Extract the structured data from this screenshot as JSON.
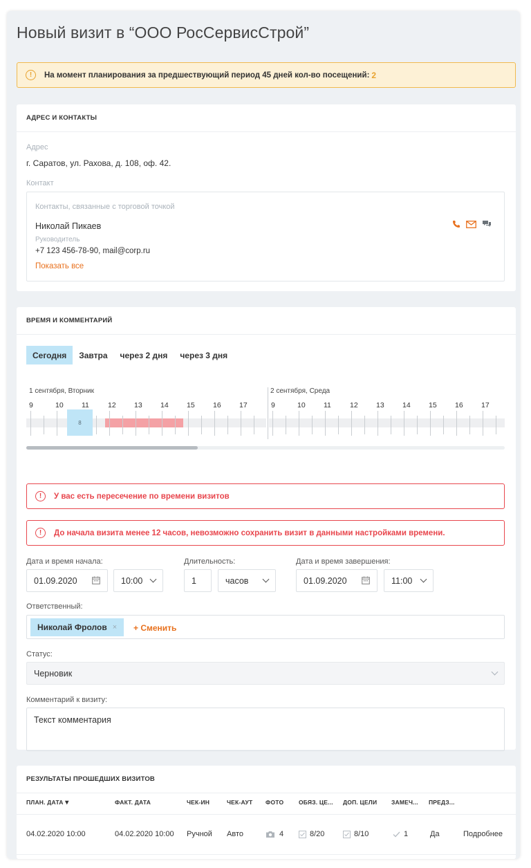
{
  "page": {
    "title": "Новый визит в “ООО РосСервисСтрой”",
    "warning_text": "На момент планирования за предшествующий период 45 дней кол-во посещений:",
    "warning_count": "2",
    "warning_icon": "!"
  },
  "address_section": {
    "heading": "АДРЕС И КОНТАКТЫ",
    "address_label": "Адрес",
    "address_value": "г. Саратов, ул. Рахова, д. 108, оф. 42.",
    "contact_label": "Контакт",
    "contacts_caption": "Контакты, связанные с торговой точкой",
    "contact_name": "Николай Пикаев",
    "contact_role": "Руководитель",
    "contact_details": "+7 123 456-78-90, mail@corp.ru",
    "show_all": "Показать все"
  },
  "time_section": {
    "heading": "ВРЕМЯ И КОММЕНТАРИЙ",
    "tabs": [
      "Сегодня",
      "Завтра",
      "через 2 дня",
      "через 3 дня"
    ],
    "active_tab": 0,
    "day1_label": "1 сентября, Вторник",
    "day2_label": "2 сентября, Среда",
    "hours": [
      "9",
      "10",
      "11",
      "12",
      "13",
      "14",
      "15",
      "16",
      "17"
    ],
    "selected_marker": "8",
    "error_overlap": "У вас есть пересечение по времени визитов",
    "error_time": "До начала визита менее 12 часов, невозможно сохранить визит в данными настройками времени.",
    "error_icon": "!",
    "start_label": "Дата и время начала:",
    "start_date": "01.09.2020",
    "start_time": "10:00",
    "duration_label": "Длительность:",
    "duration_value": "1",
    "duration_unit": "часов",
    "end_label": "Дата и время завершения:",
    "end_date": "01.09.2020",
    "end_time": "11:00",
    "responsible_label": "Ответственный:",
    "responsible_name": "Николай Фролов",
    "responsible_remove": "×",
    "change_label": "+ Сменить",
    "status_label": "Статус:",
    "status_value": "Черновик",
    "comment_label": "Комментарий к визиту:",
    "comment_value": "Текст комментария"
  },
  "results_section": {
    "heading": "РЕЗУЛЬТАТЫ ПРОШЕДШИХ ВИЗИТОВ",
    "columns": [
      "ПЛАН. ДАТА",
      "ФАКТ. ДАТА",
      "ЧЕК-ИН",
      "ЧЕК-АУТ",
      "ФОТО",
      "ОБЯЗ. ЦЕ...",
      "ДОП. ЦЕЛИ",
      "ЗАМЕЧ...",
      "ПРЕДЗ..."
    ],
    "sort_indicator": "▾",
    "row": {
      "plan_date": "04.02.2020 10:00",
      "fact_date": "04.02.2020 10:00",
      "check_in": "Ручной",
      "check_out": "Авто",
      "photo": "4",
      "required_goals": "8/20",
      "extra_goals": "8/10",
      "remarks": "1",
      "pre": "Да",
      "details_link": "Подробнее"
    }
  },
  "colors": {
    "accent_orange": "#e8711e",
    "warning_yellow": "#e8a32f",
    "error_red": "#e8464d",
    "selection_blue": "#bfe5f7",
    "busy_red": "#f4a1a5"
  }
}
